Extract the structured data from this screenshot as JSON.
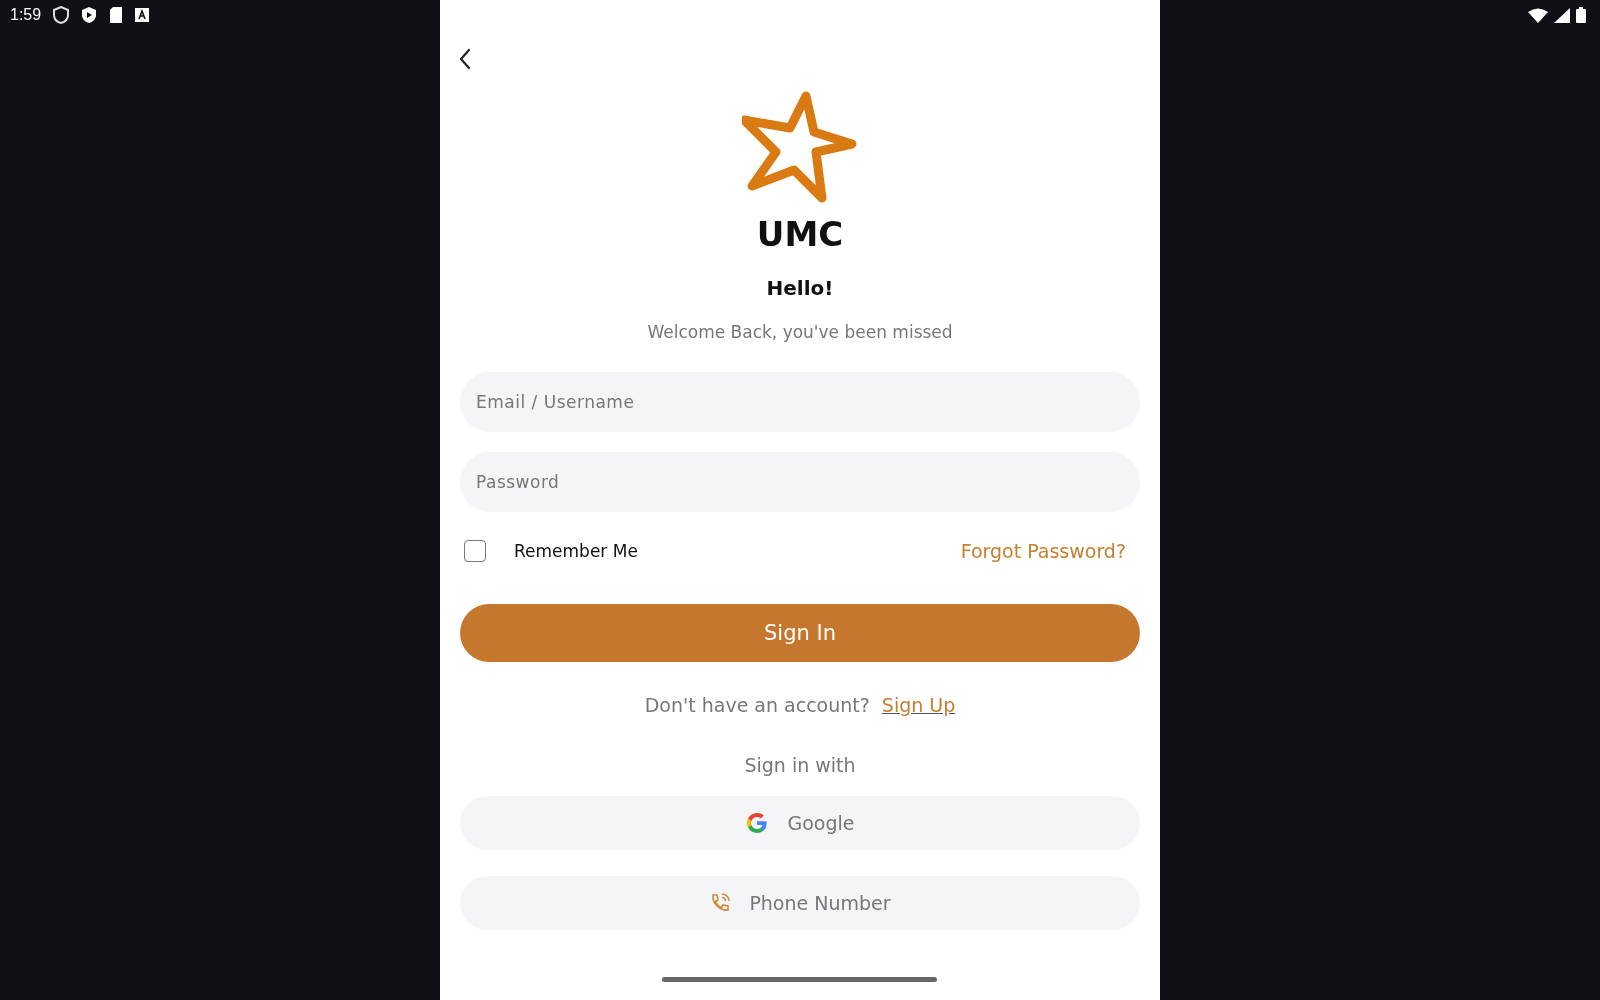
{
  "status_bar": {
    "time": "1:59"
  },
  "logo": {
    "name": "UMC"
  },
  "greeting": "Hello!",
  "subtitle": "Welcome Back, you've been missed",
  "fields": [
    {
      "placeholder": "Email / Username"
    },
    {
      "placeholder": "Password"
    }
  ],
  "remember": {
    "label": "Remember Me",
    "checked": false
  },
  "forgot_link": "Forgot Password?",
  "sign_in_button": "Sign In",
  "signup_prompt": {
    "text": "Don't have an account?",
    "link": "Sign Up"
  },
  "alt_heading": "Sign in with",
  "providers": [
    {
      "kind": "google",
      "label": "Google"
    },
    {
      "kind": "phone",
      "label": "Phone Number"
    }
  ]
}
